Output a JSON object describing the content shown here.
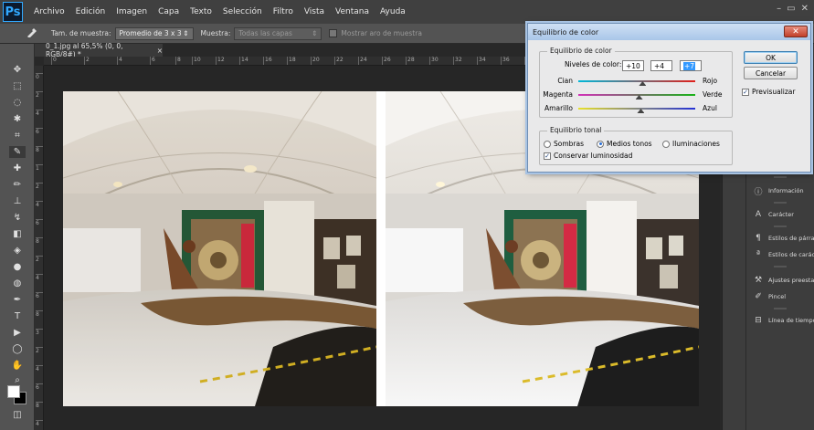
{
  "app": {
    "logo": "Ps"
  },
  "menu": [
    "Archivo",
    "Edición",
    "Imagen",
    "Capa",
    "Texto",
    "Selección",
    "Filtro",
    "Vista",
    "Ventana",
    "Ayuda"
  ],
  "window_controls": [
    "–",
    "▭",
    "✕"
  ],
  "options": {
    "sample_size_label": "Tam. de muestra:",
    "sample_size_value": "Promedio de 3 x 3",
    "sample_label": "Muestra:",
    "sample_value": "Todas las capas",
    "show_ring_label": "Mostrar aro de muestra"
  },
  "document": {
    "tab_title": "0_1.jpg al 65,5% (0, 0, RGB/8#) *",
    "tab_close": "×",
    "ruler_h": [
      "0",
      "2",
      "4",
      "6",
      "8",
      "10",
      "12",
      "14",
      "16",
      "18",
      "20",
      "22",
      "24",
      "26",
      "28",
      "30",
      "32",
      "34",
      "36",
      "38",
      "40"
    ],
    "ruler_v": [
      "0",
      "2",
      "4",
      "6",
      "8",
      "1",
      "2",
      "4",
      "6",
      "8",
      "2",
      "4",
      "6",
      "8",
      "3",
      "2",
      "4",
      "6",
      "8",
      "4"
    ]
  },
  "panels": {
    "items": [
      {
        "icon": "info-icon",
        "label": "Información"
      },
      {
        "icon": "character-icon",
        "label": "Carácter"
      },
      {
        "icon": "paragraph-styles-icon",
        "label": "Estilos de párrafo"
      },
      {
        "icon": "character-styles-icon",
        "label": "Estilos de carácter"
      },
      {
        "icon": "tool-presets-icon",
        "label": "Ajustes preestablecidos"
      },
      {
        "icon": "brush-icon",
        "label": "Pincel"
      },
      {
        "icon": "timeline-icon",
        "label": "Línea de tiempo"
      }
    ]
  },
  "dialog": {
    "title": "Equilibrio de color",
    "close": "✕",
    "balance_group": "Equilibrio de color",
    "levels_label": "Niveles de color:",
    "levels": [
      "+10",
      "+4",
      "+7"
    ],
    "sliders": [
      {
        "left": "Cian",
        "right": "Rojo",
        "value": 10,
        "from": "#00b7d8",
        "to": "#e0201a"
      },
      {
        "left": "Magenta",
        "right": "Verde",
        "value": 4,
        "from": "#d230b8",
        "to": "#18b318"
      },
      {
        "left": "Amarillo",
        "right": "Azul",
        "value": 7,
        "from": "#e7e02a",
        "to": "#2431d6"
      }
    ],
    "tone_group": "Equilibrio tonal",
    "tones": [
      "Sombras",
      "Medios tonos",
      "Iluminaciones"
    ],
    "selected_tone": "Medios tonos",
    "preserve_luminosity": "Conservar luminosidad",
    "ok": "OK",
    "cancel": "Cancelar",
    "preview": "Previsualizar"
  }
}
